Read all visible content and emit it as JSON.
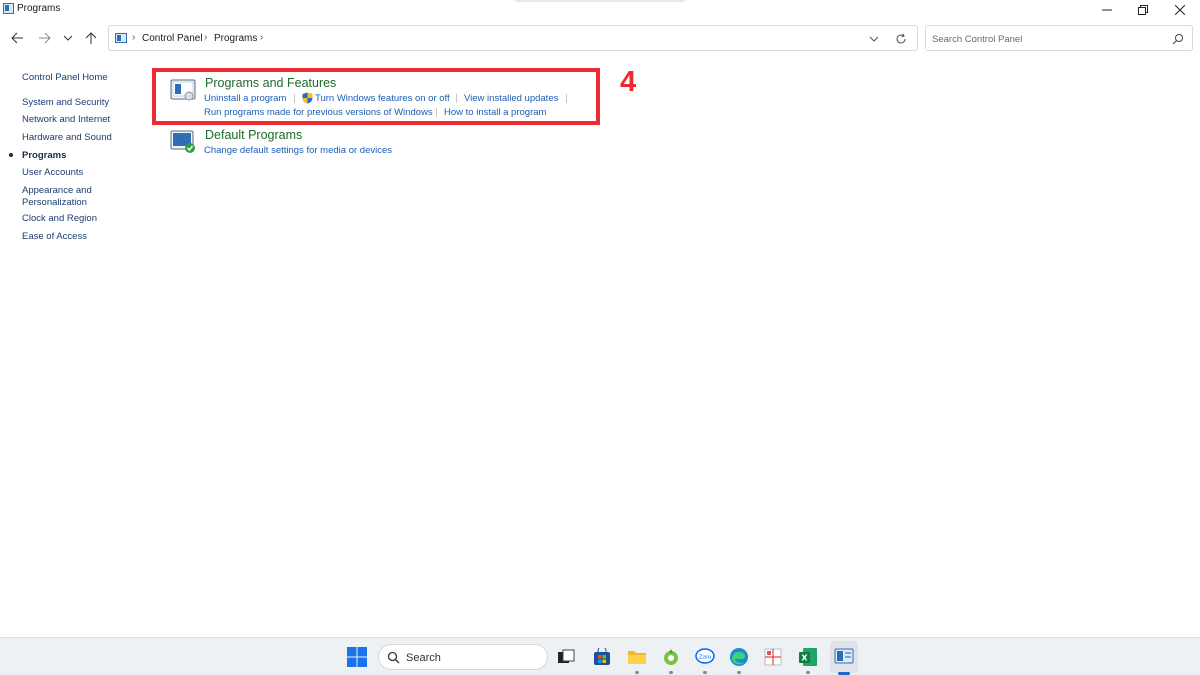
{
  "window": {
    "title": "Programs",
    "controls": {
      "minimize": "minimize-icon",
      "restore": "restore-icon",
      "close": "close-icon"
    }
  },
  "nav": {
    "back": "back-arrow-icon",
    "forward": "forward-arrow-icon",
    "recent": "chevron-down-icon",
    "up": "up-arrow-icon",
    "breadcrumb": [
      "Control Panel",
      "Programs"
    ],
    "search_placeholder": "Search Control Panel"
  },
  "sidebar": {
    "items": [
      {
        "label": "Control Panel Home",
        "active": false
      },
      {
        "label": "System and Security",
        "active": false
      },
      {
        "label": "Network and Internet",
        "active": false
      },
      {
        "label": "Hardware and Sound",
        "active": false
      },
      {
        "label": "Programs",
        "active": true
      },
      {
        "label": "User Accounts",
        "active": false
      },
      {
        "label": "Appearance and Personalization",
        "active": false
      },
      {
        "label": "Clock and Region",
        "active": false
      },
      {
        "label": "Ease of Access",
        "active": false
      }
    ]
  },
  "categories": [
    {
      "title": "Programs and Features",
      "links": [
        "Uninstall a program",
        "Turn Windows features on or off",
        "View installed updates",
        "Run programs made for previous versions of Windows",
        "How to install a program"
      ]
    },
    {
      "title": "Default Programs",
      "links": [
        "Change default settings for media or devices"
      ]
    }
  ],
  "annotation": {
    "number": "4",
    "color": "#ee2a31"
  },
  "colors": {
    "category_title": "#1f6b2c",
    "link": "#1b5fb5",
    "sidebar_link": "#1c3d6e"
  },
  "taskbar": {
    "search_label": "Search",
    "icons": [
      "windows-start-icon",
      "search-icon",
      "task-view-icon",
      "microsoft-store-icon",
      "file-explorer-icon",
      "app-green-icon",
      "zalo-icon",
      "edge-icon",
      "app-grid-icon",
      "excel-icon",
      "control-panel-icon"
    ]
  }
}
